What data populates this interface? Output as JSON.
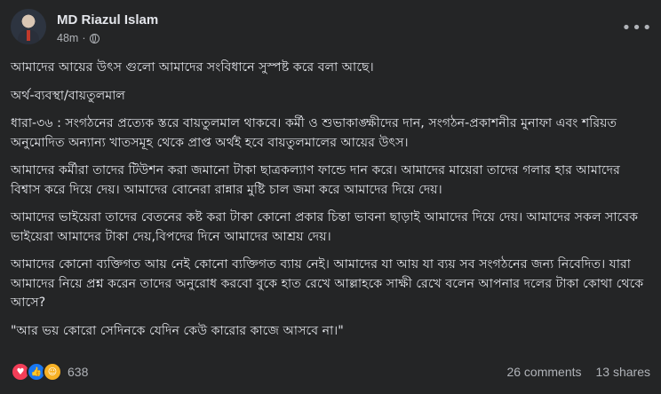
{
  "author": {
    "name": "MD Riazul Islam",
    "time": "48m",
    "privacy_icon": "globe-icon"
  },
  "menu": {
    "more_label": "•••"
  },
  "post": {
    "paragraphs": [
      "আমাদের আয়ের উৎস গুলো আমাদের সংবিধানে সুস্পষ্ট করে বলা আছে।",
      "অর্থ-ব্যবস্থা/বায়তুলমাল",
      "ধারা-৩৬ : সংগঠনের প্রত্যেক স্তরে বায়তুলমাল থাকবে। কর্মী ও শুভাকাঙ্ক্ষীদের দান, সংগঠন-প্রকাশনীর মুনাফা এবং শরিয়ত অনুমোদিত অন্যান্য খাতসমূহ থেকে প্রাপ্ত অর্থই হবে বায়তুলমালের আয়ের উৎস।",
      "আমাদের কর্মীরা তাদের টিউশন করা জমানো টাকা ছাত্রকল্যাণ ফান্ডে দান করে। আমাদের মায়েরা তাদের গলার হার আমাদের বিশ্বাস করে দিয়ে দেয়। আমাদের বোনেরা রান্নার মুষ্টি চাল জমা করে আমাদের দিয়ে দেয়।",
      "আমাদের ভাইয়েরা তাদের বেতনের কষ্ট করা টাকা কোনো প্রকার চিন্তা ভাবনা ছাড়াই আমাদের দিয়ে দেয়। আমাদের সকল সাবেক ভাইয়েরা আমাদের টাকা দেয়,বিপদের দিনে আমাদের আশ্রয় দেয়।",
      "আমাদের কোনো ব্যক্তিগত আয় নেই কোনো ব্যক্তিগত ব্যায় নেই। আমাদের যা আয় যা ব্যয় সব সংগঠনের জন্য নিবেদিত। যারা আমাদের নিয়ে প্রশ্ন করেন তাদের অনুরোধ করবো বুকে হাত রেখে আল্লাহকে সাক্ষী রেখে বলেন আপনার দলের টাকা কোথা থেকে আসে?",
      "\"আর ভয় কোরো সেদিনকে যেদিন কেউ কারোর কাজে আসবে না।\""
    ]
  },
  "stats": {
    "reactions": [
      "love",
      "like",
      "care"
    ],
    "reaction_count": "638",
    "comments": "26 comments",
    "shares": "13 shares"
  },
  "colors": {
    "background": "#242526",
    "text": "#e4e6eb",
    "secondary": "#b0b3b8"
  }
}
